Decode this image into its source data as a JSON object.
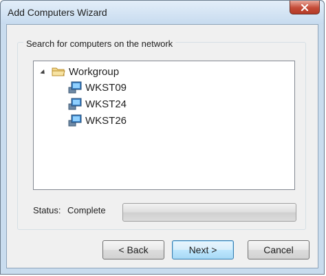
{
  "window": {
    "title": "Add Computers Wizard",
    "close_icon": "close-icon"
  },
  "search": {
    "group_label": "Search for computers on the network",
    "tree": {
      "root": {
        "label": "Workgroup",
        "icon": "folder-icon",
        "expanded": true
      },
      "children": [
        {
          "label": "WKST09",
          "icon": "computer-icon"
        },
        {
          "label": "WKST24",
          "icon": "computer-icon"
        },
        {
          "label": "WKST26",
          "icon": "computer-icon"
        }
      ]
    }
  },
  "status": {
    "label": "Status:",
    "value": "Complete",
    "progress": 0
  },
  "buttons": {
    "back": "< Back",
    "next": "Next >",
    "cancel": "Cancel"
  },
  "colors": {
    "close_button": "#c44b37",
    "default_button_border": "#3c7fb1",
    "folder": "#e8c25a"
  }
}
